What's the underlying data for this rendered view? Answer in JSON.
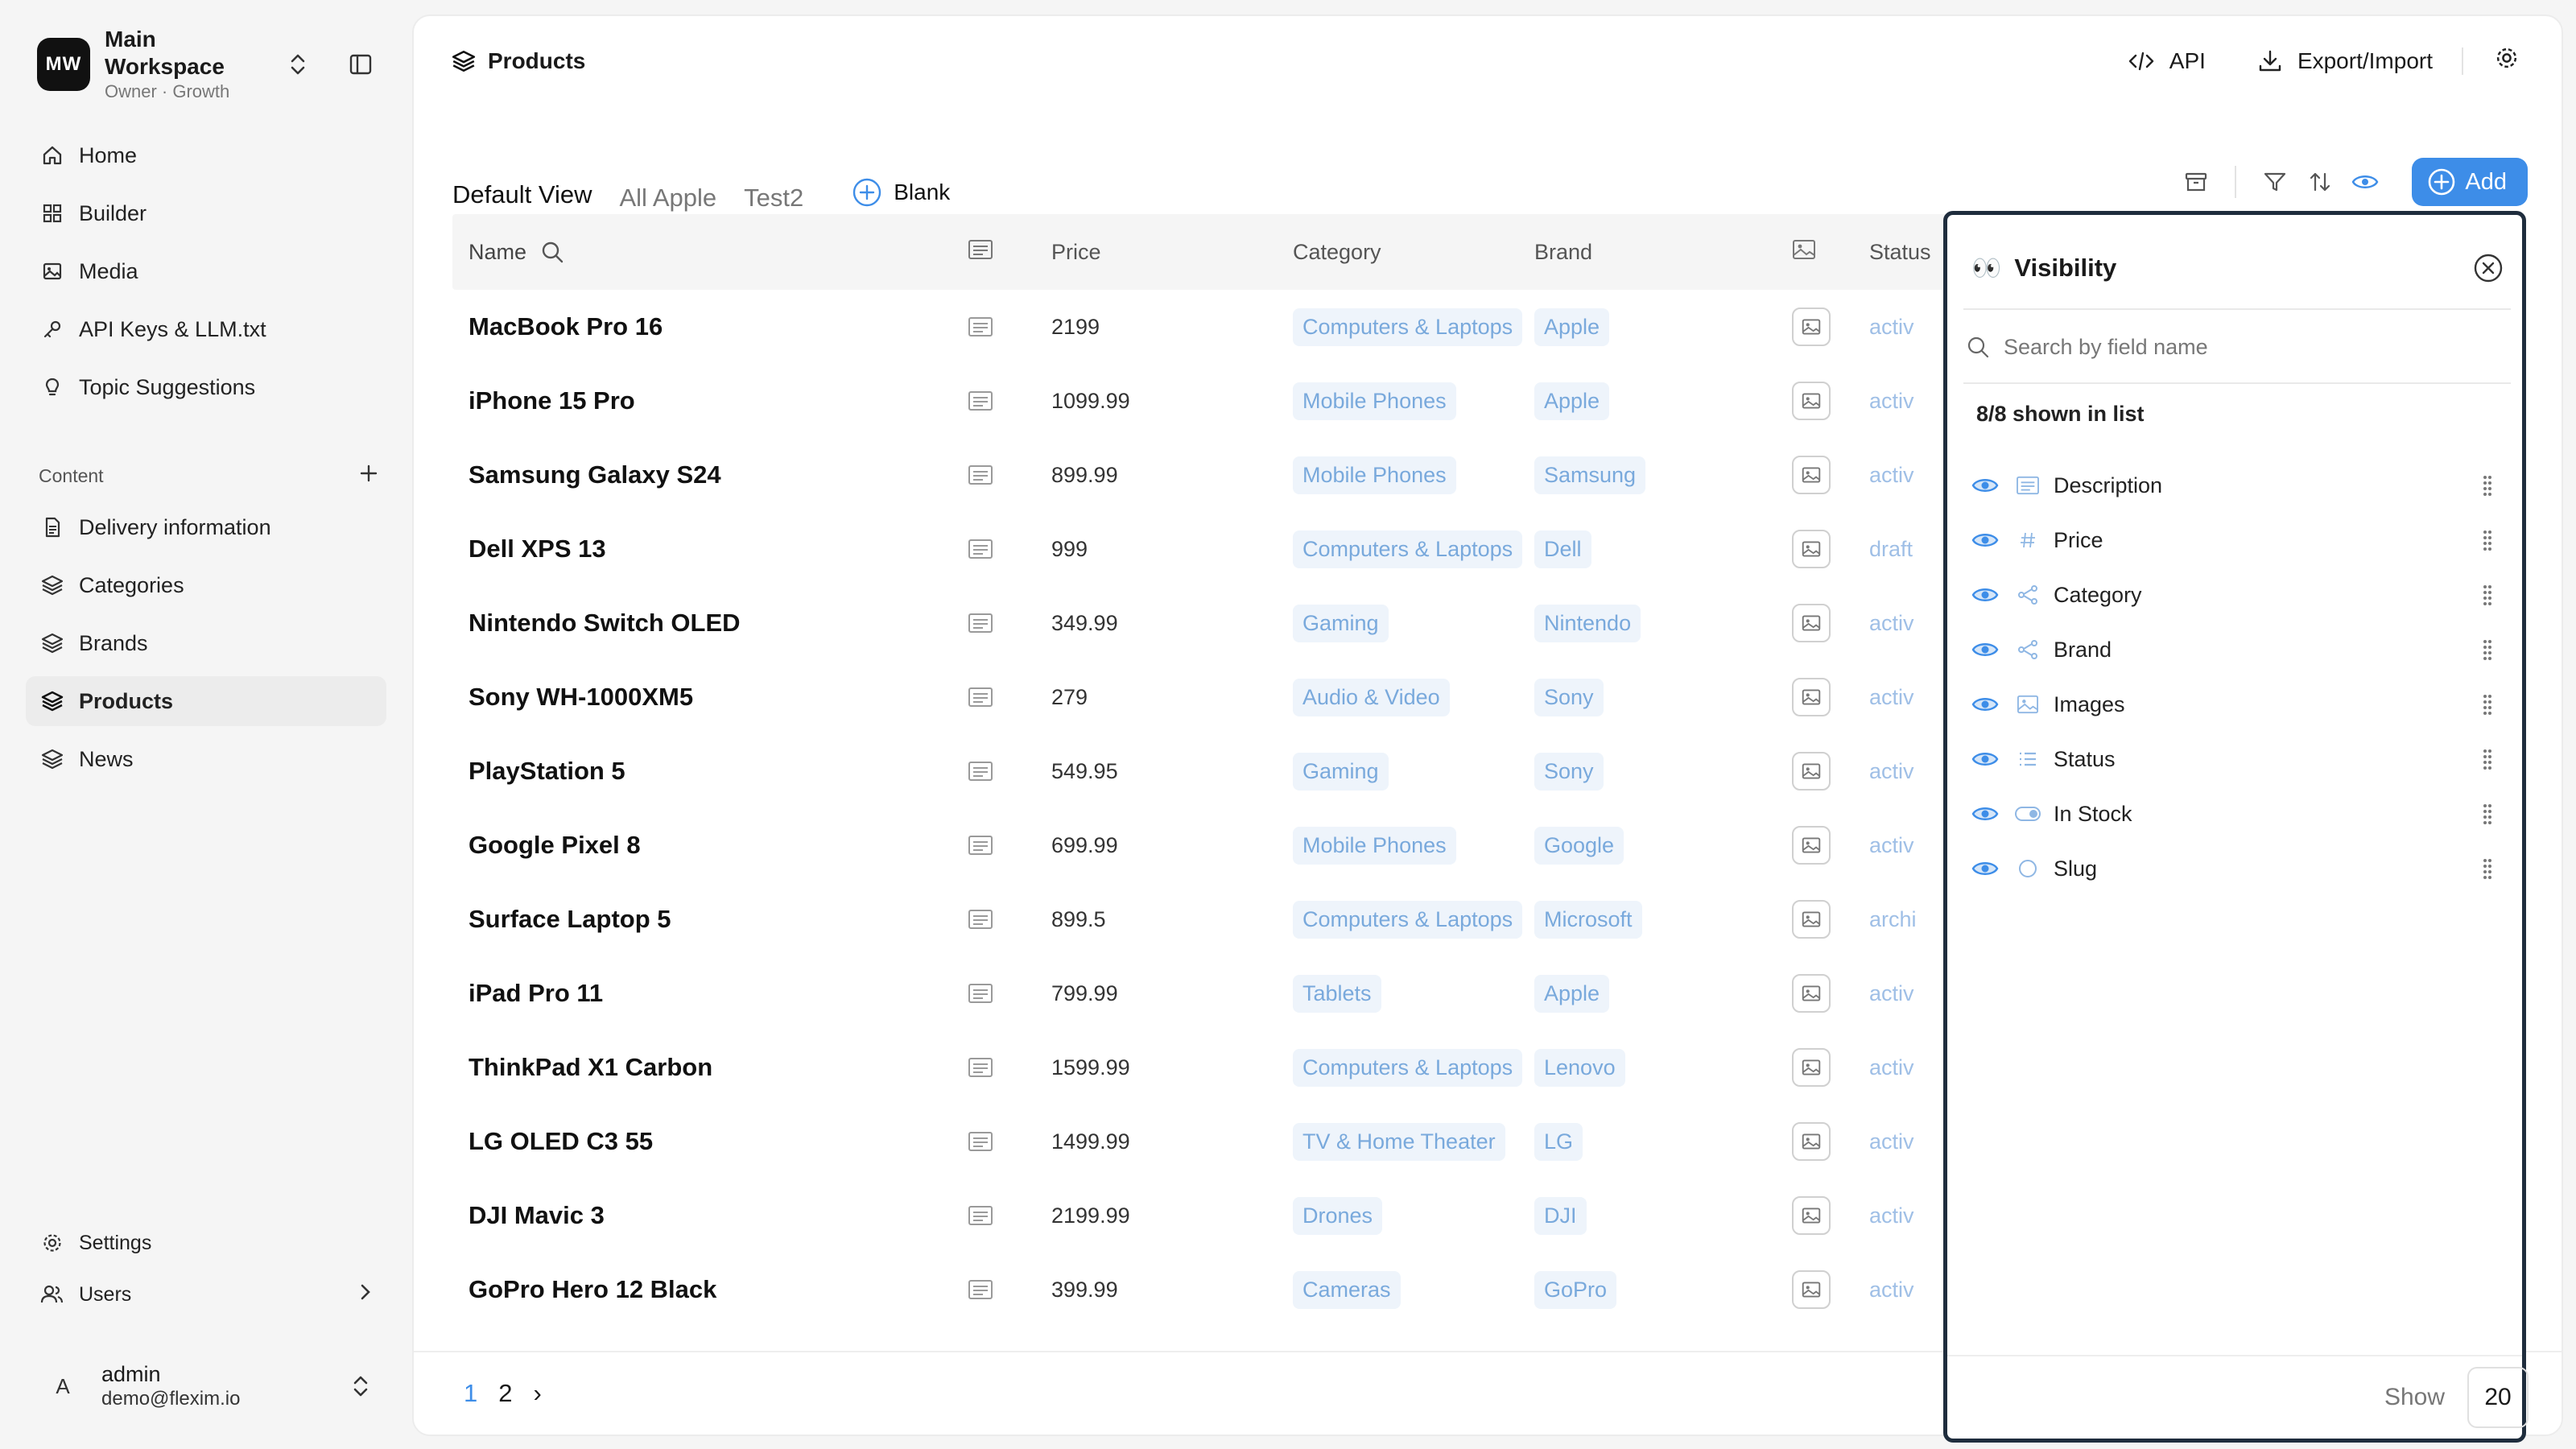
{
  "workspace": {
    "initials": "MW",
    "name": "Main Workspace",
    "sub": "Owner · Growth"
  },
  "nav": [
    {
      "label": "Home",
      "icon": "home-icon"
    },
    {
      "label": "Builder",
      "icon": "grid-icon"
    },
    {
      "label": "Media",
      "icon": "image-icon"
    },
    {
      "label": "API Keys & LLM.txt",
      "icon": "key-icon"
    },
    {
      "label": "Topic Suggestions",
      "icon": "bulb-icon"
    }
  ],
  "content_section": {
    "label": "Content"
  },
  "content_nav": [
    {
      "label": "Delivery information",
      "icon": "document-icon",
      "active": false
    },
    {
      "label": "Categories",
      "icon": "layers-icon",
      "active": false
    },
    {
      "label": "Brands",
      "icon": "layers-icon",
      "active": false
    },
    {
      "label": "Products",
      "icon": "layers-icon",
      "active": true
    },
    {
      "label": "News",
      "icon": "layers-icon",
      "active": false
    }
  ],
  "bottom_nav": {
    "settings": "Settings",
    "users": "Users"
  },
  "user": {
    "initial": "A",
    "name": "admin",
    "email": "demo@flexim.io"
  },
  "header": {
    "title": "Products",
    "api": "API",
    "export": "Export/Import"
  },
  "tabs": [
    {
      "label": "Default View",
      "active": true
    },
    {
      "label": "All Apple",
      "active": false
    },
    {
      "label": "Test2",
      "active": false
    }
  ],
  "blank_tab": "Blank",
  "add_label": "Add",
  "columns": {
    "name": "Name",
    "price": "Price",
    "category": "Category",
    "brand": "Brand",
    "status": "Status"
  },
  "rows": [
    {
      "name": "MacBook Pro 16",
      "price": "2199",
      "category": "Computers & Laptops",
      "brand": "Apple",
      "status": "activ"
    },
    {
      "name": "iPhone 15 Pro",
      "price": "1099.99",
      "category": "Mobile Phones",
      "brand": "Apple",
      "status": "activ"
    },
    {
      "name": "Samsung Galaxy S24",
      "price": "899.99",
      "category": "Mobile Phones",
      "brand": "Samsung",
      "status": "activ"
    },
    {
      "name": "Dell XPS 13",
      "price": "999",
      "category": "Computers & Laptops",
      "brand": "Dell",
      "status": "draft"
    },
    {
      "name": "Nintendo Switch OLED",
      "price": "349.99",
      "category": "Gaming",
      "brand": "Nintendo",
      "status": "activ"
    },
    {
      "name": "Sony WH-1000XM5",
      "price": "279",
      "category": "Audio & Video",
      "brand": "Sony",
      "status": "activ"
    },
    {
      "name": "PlayStation 5",
      "price": "549.95",
      "category": "Gaming",
      "brand": "Sony",
      "status": "activ"
    },
    {
      "name": "Google Pixel 8",
      "price": "699.99",
      "category": "Mobile Phones",
      "brand": "Google",
      "status": "activ"
    },
    {
      "name": "Surface Laptop 5",
      "price": "899.5",
      "category": "Computers & Laptops",
      "brand": "Microsoft",
      "status": "archi"
    },
    {
      "name": "iPad Pro 11",
      "price": "799.99",
      "category": "Tablets",
      "brand": "Apple",
      "status": "activ"
    },
    {
      "name": "ThinkPad X1 Carbon",
      "price": "1599.99",
      "category": "Computers & Laptops",
      "brand": "Lenovo",
      "status": "activ"
    },
    {
      "name": "LG OLED C3 55",
      "price": "1499.99",
      "category": "TV & Home Theater",
      "brand": "LG",
      "status": "activ"
    },
    {
      "name": "DJI Mavic 3",
      "price": "2199.99",
      "category": "Drones",
      "brand": "DJI",
      "status": "activ"
    },
    {
      "name": "GoPro Hero 12 Black",
      "price": "399.99",
      "category": "Cameras",
      "brand": "GoPro",
      "status": "activ"
    }
  ],
  "pagination": {
    "page1": "1",
    "page2": "2",
    "next": "›"
  },
  "visibility": {
    "title": "Visibility",
    "eyes": "👀",
    "search_placeholder": "Search by field name",
    "count": "8/8 shown in list",
    "fields": [
      {
        "label": "Description",
        "type_icon": "text-icon"
      },
      {
        "label": "Price",
        "type_icon": "hash-icon"
      },
      {
        "label": "Category",
        "type_icon": "relation-icon"
      },
      {
        "label": "Brand",
        "type_icon": "relation-icon"
      },
      {
        "label": "Images",
        "type_icon": "image-icon"
      },
      {
        "label": "Status",
        "type_icon": "list-icon"
      },
      {
        "label": "In Stock",
        "type_icon": "toggle-icon"
      },
      {
        "label": "Slug",
        "type_icon": "circle-icon"
      }
    ],
    "show_label": "Show",
    "show_value": "20"
  },
  "colors": {
    "accent": "#3d8de8",
    "tag_bg": "#eef4fb",
    "tag_text": "#79a9dc",
    "panel_border": "#1f2d3d"
  }
}
